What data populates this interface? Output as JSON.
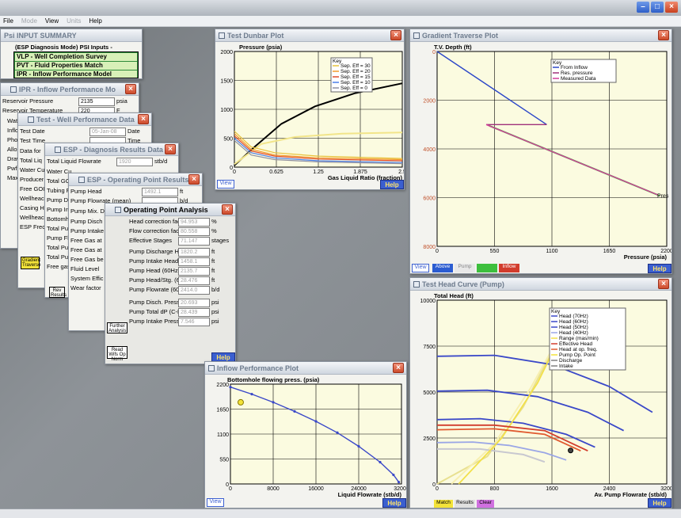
{
  "menu": [
    "File",
    "Mode",
    "View",
    "Units",
    "Help"
  ],
  "menu_disabled": [
    false,
    true,
    false,
    true,
    false
  ],
  "summary": {
    "title": "Psi INPUT SUMMARY",
    "mode": "(ESP Diagnosis Mode)",
    "inputs": "PSI Inputs -",
    "rows": [
      "VLP - Well Completion Survey",
      "PVT - Fluid Properties Match",
      "IPR - Inflow Performance Model"
    ]
  },
  "ipr": {
    "title": "IPR - Inflow Performance Mo",
    "rows": [
      {
        "label": "Reservoir Pressure",
        "value": "2135",
        "unit": "psia"
      },
      {
        "label": "Reservoir Temperature",
        "value": "220",
        "unit": "F"
      }
    ],
    "side": [
      "Wat",
      "Inflo",
      "Pho",
      "Allo",
      "Draw",
      "Pwf",
      "Max"
    ]
  },
  "wpd": {
    "title": "Test - Well Performance Data",
    "rows": [
      {
        "label": "Test Date",
        "value": "05-Jan-08",
        "unit": "Date"
      },
      {
        "label": "Test Time",
        "value": "",
        "unit": "Time"
      }
    ],
    "side": [
      "Data for",
      "Total Liq",
      "Water Cu",
      "Producer",
      "Free GOI",
      "Wellheac",
      "Casing H",
      "Wellheac",
      "ESP Frec"
    ]
  },
  "dr": {
    "title": "ESP - Diagnosis Results Data",
    "rows": [
      {
        "label": "Total Liquid Flowrate",
        "value": "1920",
        "unit": "stb/d"
      }
    ],
    "side": [
      "Water Cu",
      "Total GO",
      "Tubing F",
      "Pump Dis",
      "Pump Int",
      "Bottomh",
      "Total Pu",
      "Pump Fl",
      "Total Pu",
      "Total Pu",
      "Free gas"
    ],
    "button": "Gradient Traverse"
  },
  "op": {
    "title": "ESP - Operating Point Results",
    "rows": [
      {
        "label": "Pump Head",
        "value": "1492.1",
        "unit": "ft"
      },
      {
        "label": "Pump Flowrate (mean)",
        "value": "",
        "unit": "b/d"
      },
      {
        "label": "Pump Mix. D",
        "value": "",
        "unit": ""
      }
    ],
    "side": [
      "Pump Disch",
      "Pump Intake",
      "Free Gas at",
      "Free Gas at",
      "Free Gas be",
      "Fluid Level",
      "System Effic",
      "Wear factor"
    ],
    "button": "Rev Results"
  },
  "opa": {
    "title": "Operating Point Analysis",
    "rows": [
      {
        "label": "Head correction factor (Ch)",
        "value": "94.953",
        "unit": "%"
      },
      {
        "label": "Flow correction factor (Cq)",
        "value": "80.558",
        "unit": "%"
      },
      {
        "label": "Effective Stages",
        "value": "71.147",
        "unit": "stages"
      },
      {
        "label": "Pump Discharge Head",
        "value": "1820.2",
        "unit": "ft"
      },
      {
        "label": "Pump Intake Head",
        "value": "1458.1",
        "unit": "ft"
      },
      {
        "label": "Pump Head (60Hz)",
        "value": "2135.7",
        "unit": "ft"
      },
      {
        "label": "Pump Head/Stg. (60Hz)",
        "value": "28.476",
        "unit": "ft"
      },
      {
        "label": "Pump Flowrate (60Hz)",
        "value": "2414.0",
        "unit": "b/d"
      },
      {
        "label": "Pump Disch. Press (C-M)",
        "value": "20.693",
        "unit": "psi"
      },
      {
        "label": "Pump Total dP (C-M)",
        "value": "28.439",
        "unit": "psi"
      },
      {
        "label": "Pump Intake Press (C-M)",
        "value": "7.546",
        "unit": "psi"
      }
    ],
    "further": "Further Analysis",
    "readbtn": "Read Wifs Op Norm",
    "help": "Help"
  },
  "tdp": {
    "title": "Test Dunbar Plot",
    "help": "Help",
    "view": "View"
  },
  "gtp": {
    "title": "Gradient Traverse Plot",
    "help": "Help",
    "view": "View",
    "tabs": [
      "Above",
      "Pump",
      "",
      "Inflow"
    ],
    "tab_colors": [
      "#2b5cd1",
      "#e8e8e8",
      "#3dbf3d",
      "#d23c2c"
    ]
  },
  "hcp": {
    "title": "Test Head Curve (Pump)",
    "help": "Help",
    "tabs": [
      "Match",
      "Results",
      "Clear"
    ],
    "tab_colors": [
      "#f3e339",
      "#e0e0e0",
      "#d070e0"
    ]
  },
  "ipp": {
    "title": "Inflow Performance Plot",
    "help": "Help",
    "view": "View"
  },
  "colors": {
    "accent": "#3b5fd0",
    "plot_bg": "#fbfbe0"
  },
  "chart_data": [
    {
      "type": "line",
      "title": "Pressure (psia)",
      "xlabel": "Gas Liquid Ratio (fraction)",
      "ylabel": "",
      "xlim": [
        0,
        2.5
      ],
      "ylim": [
        0,
        2000
      ],
      "xticks": [
        "0",
        "0.625",
        "1.25",
        "1.875",
        "2.5"
      ],
      "yticks": [
        "0",
        "500",
        "1000",
        "1500",
        "2000"
      ],
      "legend_title": "Key",
      "series": [
        {
          "name": "Sep. Eff = 30",
          "color": "#e8c23a",
          "points": [
            [
              0,
              620
            ],
            [
              0.25,
              350
            ],
            [
              0.6,
              250
            ],
            [
              1.25,
              190
            ],
            [
              2.5,
              150
            ]
          ]
        },
        {
          "name": "Sep. Eff = 20",
          "color": "#f39b2a",
          "points": [
            [
              0,
              580
            ],
            [
              0.25,
              310
            ],
            [
              0.6,
              210
            ],
            [
              1.25,
              160
            ],
            [
              2.5,
              130
            ]
          ]
        },
        {
          "name": "Sep. Eff = 15",
          "color": "#e04a2a",
          "points": [
            [
              0,
              540
            ],
            [
              0.25,
              280
            ],
            [
              0.6,
              190
            ],
            [
              1.25,
              140
            ],
            [
              2.5,
              110
            ]
          ]
        },
        {
          "name": "Sep. Eff = 10",
          "color": "#4a7de8",
          "points": [
            [
              0,
              500
            ],
            [
              0.25,
              250
            ],
            [
              0.6,
              160
            ],
            [
              1.25,
              110
            ],
            [
              2.5,
              80
            ]
          ]
        },
        {
          "name": "Sep. Eff = 0",
          "color": "#9090a0",
          "points": [
            [
              0,
              460
            ],
            [
              0.25,
              210
            ],
            [
              0.6,
              130
            ],
            [
              1.25,
              90
            ],
            [
              2.5,
              60
            ]
          ]
        }
      ],
      "extra": [
        {
          "color": "#000",
          "points": [
            [
              0,
              30
            ],
            [
              0.3,
              350
            ],
            [
              0.7,
              750
            ],
            [
              1.2,
              1050
            ],
            [
              1.8,
              1280
            ],
            [
              2.5,
              1450
            ]
          ]
        },
        {
          "color": "#f2e58a",
          "points": [
            [
              0,
              50
            ],
            [
              0.4,
              400
            ],
            [
              0.9,
              520
            ],
            [
              1.6,
              580
            ],
            [
              2.5,
              600
            ]
          ]
        }
      ]
    },
    {
      "type": "line",
      "title": "T.V. Depth (ft)",
      "xlabel": "Pressure (psia)",
      "xlim": [
        0,
        2200
      ],
      "ylim": [
        0,
        8000
      ],
      "xticks": [
        "0",
        "550",
        "1100",
        "1650",
        "2200"
      ],
      "yticks": [
        "0",
        "2000",
        "4000",
        "6000",
        "8000"
      ],
      "legend_title": "Key",
      "series": [
        {
          "name": "From Inflow",
          "color": "#2b46c8",
          "points": [
            [
              0,
              0
            ],
            [
              1050,
              3000
            ]
          ]
        },
        {
          "name": "Res. pressure",
          "color": "#a0307a",
          "points": [
            [
              1050,
              3000
            ],
            [
              470,
              3000
            ]
          ]
        },
        {
          "name": "Measured Data",
          "color": "#d23c9a",
          "points": [
            [
              470,
              3000
            ],
            [
              2120,
              5900
            ]
          ]
        }
      ],
      "extra": [
        {
          "color": "#3dbf3d",
          "points": [
            [
              500,
              3050
            ],
            [
              2130,
              5920
            ]
          ]
        }
      ],
      "annotation": "Pres"
    },
    {
      "type": "line",
      "title": "Total Head (ft)",
      "xlabel": "Av. Pump Flowrate (stb/d)",
      "xlim": [
        0,
        3200
      ],
      "ylim": [
        0,
        10000
      ],
      "xticks": [
        "0",
        "800",
        "1600",
        "2400",
        "3200"
      ],
      "yticks": [
        "0",
        "2500",
        "5000",
        "7500",
        "10000"
      ],
      "legend_title": "Key",
      "series": [
        {
          "name": "Head (70Hz)",
          "color": "#3a48c8",
          "points": [
            [
              0,
              6950
            ],
            [
              800,
              7000
            ],
            [
              1600,
              6500
            ],
            [
              2400,
              5300
            ],
            [
              3000,
              3900
            ]
          ]
        },
        {
          "name": "Head (60Hz)",
          "color": "#3a48c8",
          "points": [
            [
              0,
              5050
            ],
            [
              700,
              5100
            ],
            [
              1400,
              4750
            ],
            [
              2100,
              3900
            ],
            [
              2600,
              2900
            ]
          ]
        },
        {
          "name": "Head (50Hz)",
          "color": "#3a48c8",
          "points": [
            [
              0,
              3500
            ],
            [
              600,
              3550
            ],
            [
              1200,
              3300
            ],
            [
              1800,
              2700
            ],
            [
              2200,
              2000
            ]
          ]
        },
        {
          "name": "Head (40Hz)",
          "color": "#9aa6e6",
          "points": [
            [
              0,
              2250
            ],
            [
              500,
              2280
            ],
            [
              1000,
              2100
            ],
            [
              1500,
              1700
            ],
            [
              1800,
              1300
            ]
          ]
        },
        {
          "name": "Range (mas/min)",
          "color": "#f2e04a",
          "points": [
            [
              300,
              0
            ],
            [
              900,
              2500
            ],
            [
              1400,
              5500
            ],
            [
              1900,
              9500
            ]
          ]
        },
        {
          "name": "Effective Head",
          "color": "#d23c2c",
          "points": [
            [
              0,
              3200
            ],
            [
              800,
              3200
            ],
            [
              1500,
              2900
            ],
            [
              2100,
              1800
            ]
          ]
        },
        {
          "name": "Head at op. freq.",
          "color": "#e05a30",
          "points": [
            [
              0,
              2950
            ],
            [
              800,
              3000
            ],
            [
              1500,
              2700
            ],
            [
              2000,
              1800
            ]
          ]
        },
        {
          "name": "Pump Op. Point",
          "color": "#f3e339",
          "points": [
            [
              1860,
              1820
            ]
          ]
        },
        {
          "name": "Discharge",
          "color": "#808080",
          "points": []
        },
        {
          "name": "Intake",
          "color": "#808080",
          "points": []
        }
      ],
      "extra": [
        {
          "color": "#e8e090",
          "points": [
            [
              0,
              0
            ],
            [
              700,
              1500
            ],
            [
              1200,
              4200
            ],
            [
              1600,
              7200
            ]
          ]
        },
        {
          "color": "#f7efb0",
          "points": [
            [
              200,
              0
            ],
            [
              800,
              2200
            ],
            [
              1300,
              5200
            ],
            [
              1700,
              8000
            ]
          ]
        },
        {
          "color": "#c8c8d0",
          "points": [
            [
              0,
              1900
            ],
            [
              600,
              1900
            ],
            [
              1200,
              1600
            ],
            [
              1500,
              1200
            ]
          ]
        }
      ]
    },
    {
      "type": "line",
      "title": "Bottomhole flowing press. (psia)",
      "xlabel": "Liquid Flowrate (stb/d)",
      "xlim": [
        0,
        32000
      ],
      "ylim": [
        0,
        2200
      ],
      "xticks": [
        "0",
        "8000",
        "16000",
        "24000",
        "32000"
      ],
      "yticks": [
        "0",
        "550",
        "1100",
        "1650",
        "2200"
      ],
      "series": [
        {
          "name": "",
          "color": "#3a48c8",
          "points": [
            [
              0,
              2135
            ],
            [
              4000,
              1980
            ],
            [
              8000,
              1800
            ],
            [
              12000,
              1600
            ],
            [
              16000,
              1380
            ],
            [
              20000,
              1130
            ],
            [
              24000,
              830
            ],
            [
              28000,
              480
            ],
            [
              30500,
              200
            ],
            [
              31500,
              40
            ]
          ]
        }
      ],
      "op_point": [
        1920,
        1800
      ]
    }
  ]
}
